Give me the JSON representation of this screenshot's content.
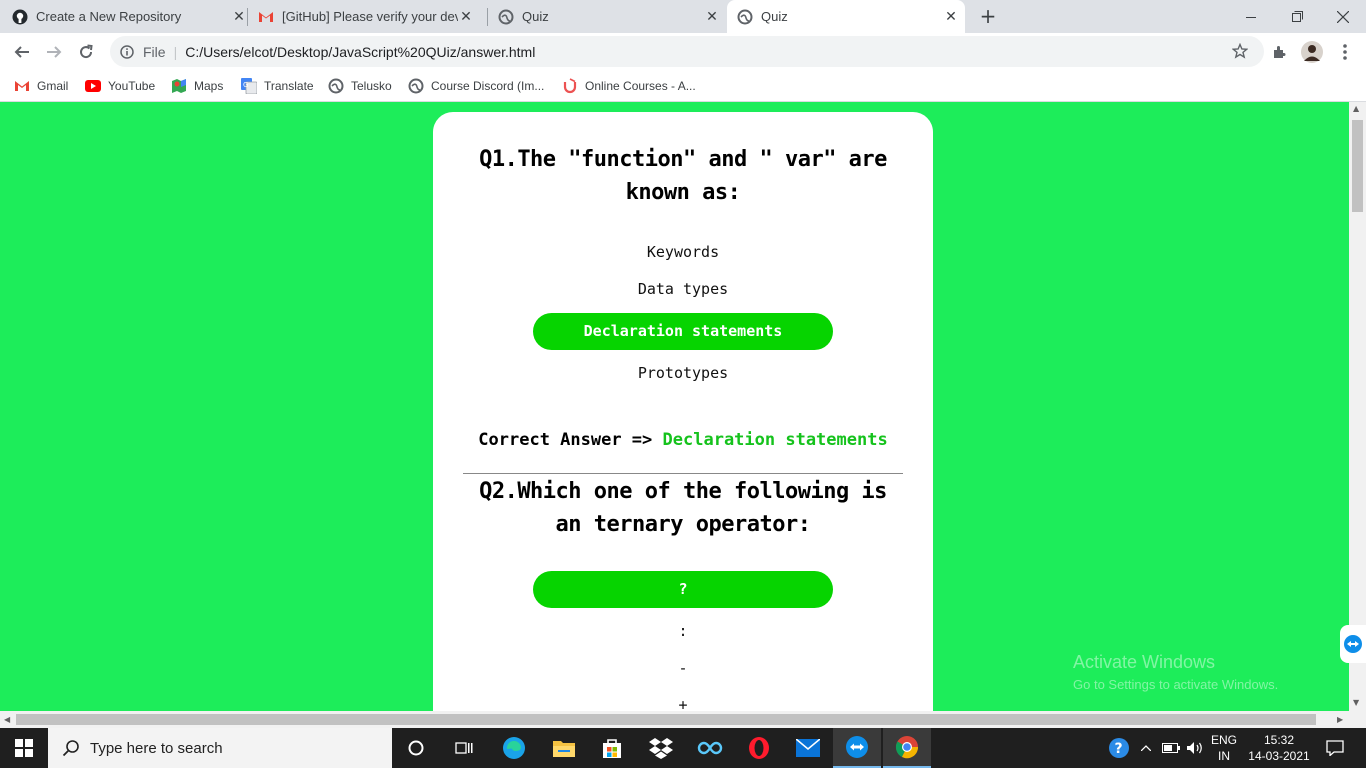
{
  "tabs": [
    {
      "title": "Create a New Repository",
      "icon": "github-icon"
    },
    {
      "title": "[GitHub] Please verify your device",
      "icon": "gmail-icon"
    },
    {
      "title": "Quiz",
      "icon": "globe-icon"
    },
    {
      "title": "Quiz",
      "icon": "globe-icon",
      "active": true
    }
  ],
  "address": {
    "scheme_label": "File",
    "url": "C:/Users/elcot/Desktop/JavaScript%20QUiz/answer.html"
  },
  "bookmarks": [
    {
      "label": "Gmail",
      "icon": "gmail-icon"
    },
    {
      "label": "YouTube",
      "icon": "youtube-icon"
    },
    {
      "label": "Maps",
      "icon": "maps-icon"
    },
    {
      "label": "Translate",
      "icon": "translate-icon"
    },
    {
      "label": "Telusko",
      "icon": "globe-icon"
    },
    {
      "label": "Course Discord (Im...",
      "icon": "globe-icon"
    },
    {
      "label": "Online Courses - A...",
      "icon": "udemy-icon"
    }
  ],
  "quiz": {
    "q1": {
      "question": "Q1.The \"function\" and \" var\" are known as:",
      "options": [
        "Keywords",
        "Data types",
        "Declaration statements",
        "Prototypes"
      ],
      "selected": "Declaration statements",
      "correct_label": "Correct Answer =>",
      "correct_answer": "Declaration statements"
    },
    "q2": {
      "question": "Q2.Which one of the following is an ternary operator:",
      "options": [
        "?",
        ":",
        "-",
        "+"
      ],
      "selected": "?"
    }
  },
  "watermark": {
    "title": "Activate Windows",
    "subtitle": "Go to Settings to activate Windows."
  },
  "taskbar": {
    "search_placeholder": "Type here to search",
    "lang": "ENG",
    "region": "IN",
    "time": "15:32",
    "date": "14-03-2021"
  },
  "colors": {
    "page_bg": "#1ded5a",
    "selected_option": "#06d400",
    "correct_text": "#15c21c"
  }
}
